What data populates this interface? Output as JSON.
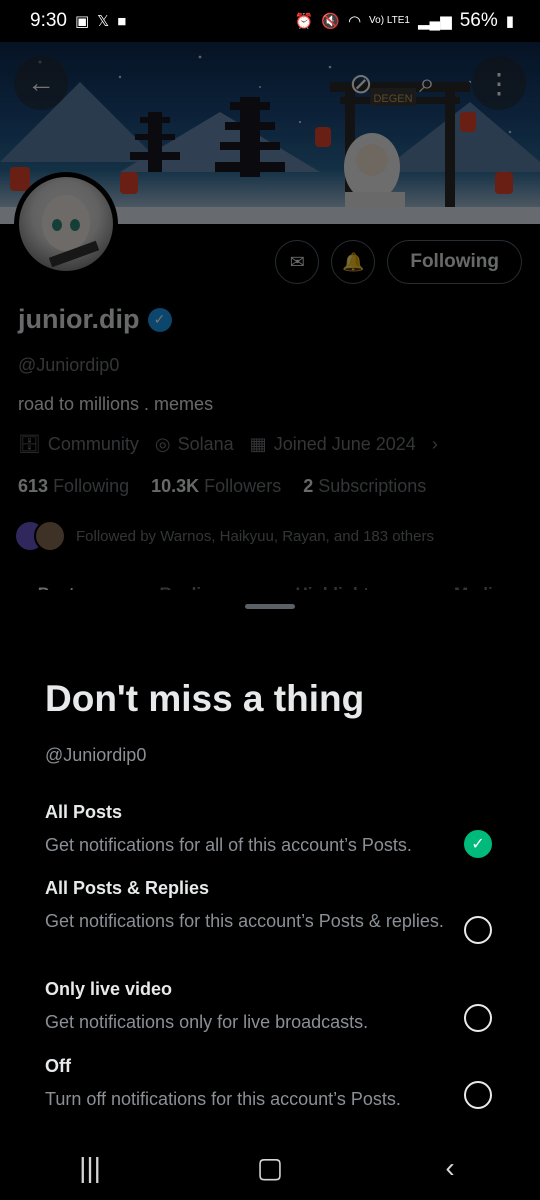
{
  "status_bar": {
    "time": "9:30",
    "left_icons": [
      "gallery-icon",
      "x-app-icon",
      "folder-icon"
    ],
    "right_icons": [
      "alarm-icon",
      "clock-icon",
      "mute-icon",
      "wifi-icon"
    ],
    "network": "Vo) LTE1",
    "battery": "56%"
  },
  "banner": {
    "sign_text": "DEGEN"
  },
  "profile": {
    "display_name": "junior.dip",
    "handle": "@Juniordip0",
    "bio": "road to millions . memes",
    "category": "Community",
    "location": "Solana",
    "joined": "Joined June 2024",
    "following_count": "613",
    "following_label": "Following",
    "followers_count": "10.3K",
    "followers_label": "Followers",
    "subscriptions_count": "2",
    "subscriptions_label": "Subscriptions",
    "followed_by": "Followed by Warnos, Haikyuu, Rayan, and 183 others",
    "follow_button": "Following",
    "tabs": [
      "Posts",
      "Replies",
      "Highlights",
      "Media"
    ]
  },
  "sheet": {
    "title": "Don't miss a thing",
    "handle": "@Juniordip0",
    "options": [
      {
        "title": "All Posts",
        "desc": "Get notifications for all of this account’s Posts.",
        "checked": true
      },
      {
        "title": "All Posts & Replies",
        "desc": "Get notifications for this account’s Posts & replies.",
        "checked": false
      },
      {
        "title": "Only live video",
        "desc": "Get notifications only for live broadcasts.",
        "checked": false
      },
      {
        "title": "Off",
        "desc": "Turn off notifications for this account’s Posts.",
        "checked": false
      }
    ]
  },
  "colors": {
    "verified": "#1d9bf0",
    "checked_radio": "#00ba7c",
    "secondary_text": "#71767b"
  }
}
